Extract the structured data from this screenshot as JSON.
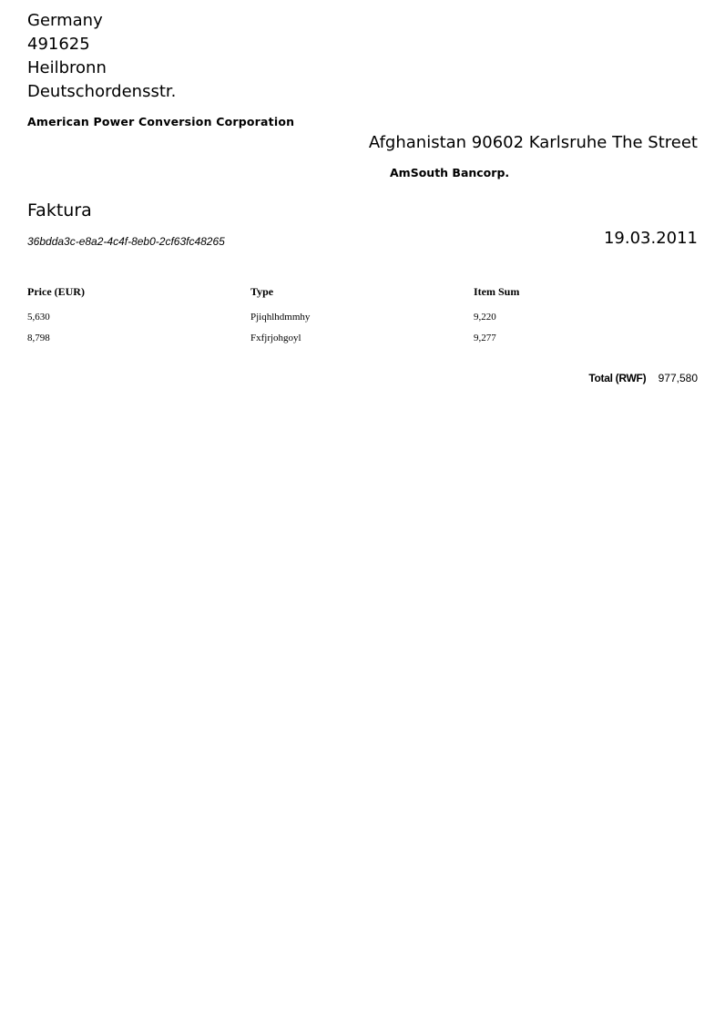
{
  "sender": {
    "country": "Germany",
    "postal_code": "491625",
    "city": "Heilbronn",
    "street": "Deutschordensstr.",
    "company": "American Power Conversion Corporation"
  },
  "recipient": {
    "address": "Afghanistan 90602 Karlsruhe The Street",
    "company": "AmSouth Bancorp."
  },
  "document": {
    "title": "Faktura",
    "id": "36bdda3c-e8a2-4c4f-8eb0-2cf63fc48265",
    "date": "19.03.2011"
  },
  "table": {
    "headers": [
      "Price (EUR)",
      "Type",
      "Item Sum"
    ],
    "rows": [
      [
        "5,630",
        "Pjiqhlhdmmhy",
        "9,220"
      ],
      [
        "8,798",
        "Fxfjrjohgoyl",
        "9,277"
      ]
    ]
  },
  "total": {
    "label": "Total (RWF)",
    "value": "977,580"
  }
}
